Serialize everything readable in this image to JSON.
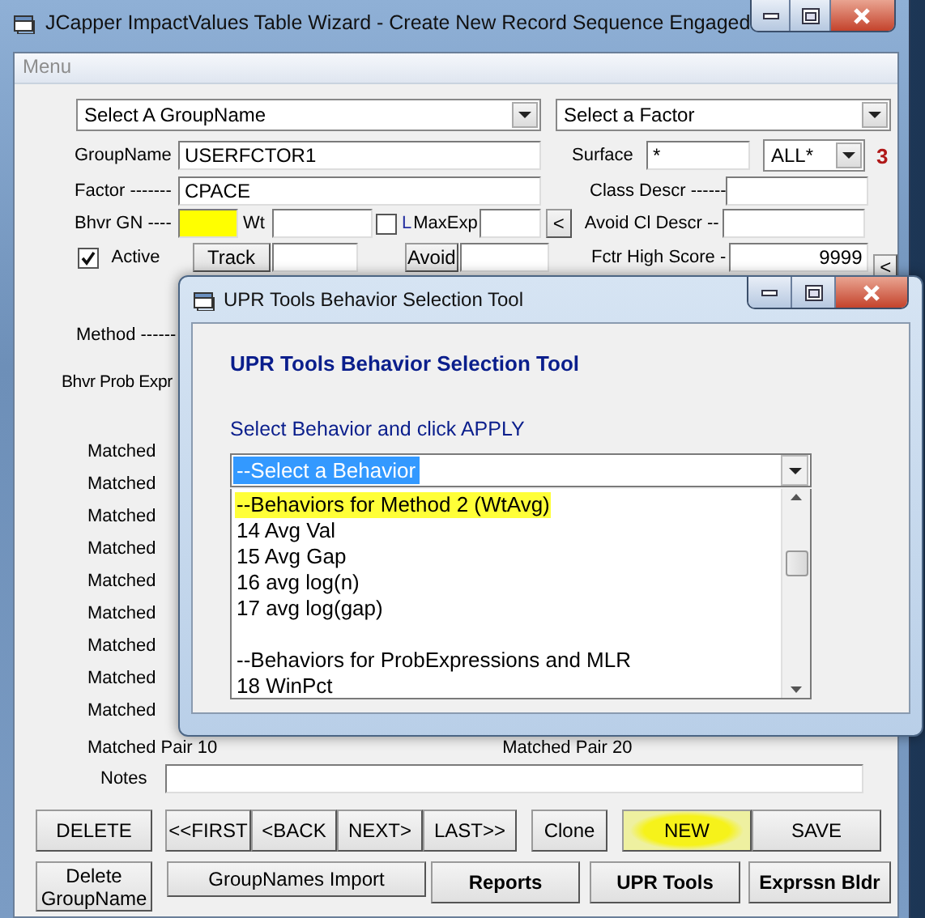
{
  "window": {
    "title": "JCapper ImpactValues Table Wizard -  Create New Record Sequence Engaged"
  },
  "menu": {
    "label": "Menu",
    "disabled": true
  },
  "group_combo": {
    "value": "Select A GroupName"
  },
  "factor_combo": {
    "value": "Select a Factor"
  },
  "group_name": {
    "label": "GroupName",
    "value": "USERFCTOR1"
  },
  "surface": {
    "label": "Surface",
    "value": "*",
    "option": "ALL*",
    "count": "3"
  },
  "factor": {
    "label": "Factor -------",
    "value": "CPACE"
  },
  "class_descr": {
    "label": "Class Descr ------"
  },
  "bhvr_gn": {
    "label": "Bhvr GN ----",
    "highlighted": true
  },
  "wt": {
    "label": "Wt"
  },
  "l_check": {
    "label": "L",
    "checked": false
  },
  "max_exp": {
    "label": "MaxExp",
    "button": "<"
  },
  "avoid_cl_descr": {
    "label": "Avoid Cl Descr --"
  },
  "active": {
    "label": "Active",
    "checked": true
  },
  "track_button": "Track",
  "avoid_button": "Avoid",
  "fctr_high_score": {
    "label": "Fctr High Score -",
    "value": "9999",
    "button": "<"
  },
  "method_label": "Method ------",
  "bhvr_prob_expr_label": "Bhvr Prob Expr",
  "matched_labels": [
    "Matched",
    "Matched",
    "Matched",
    "Matched",
    "Matched",
    "Matched",
    "Matched",
    "Matched",
    "Matched"
  ],
  "matched_pair_labels": [
    "Matched Pair 10",
    "Matched Pair 20"
  ],
  "notes_label": "Notes",
  "buttons_row1": [
    {
      "label": "DELETE",
      "highlighted": false
    },
    {
      "label": "<<FIRST",
      "highlighted": false
    },
    {
      "label": "<BACK",
      "highlighted": false
    },
    {
      "label": "NEXT>",
      "highlighted": false
    },
    {
      "label": "LAST>>",
      "highlighted": false
    },
    {
      "label": "Clone",
      "highlighted": false
    },
    {
      "label": "NEW",
      "highlighted": true
    },
    {
      "label": "SAVE",
      "highlighted": false
    }
  ],
  "buttons_row2": [
    {
      "label": "Delete GroupName",
      "bold": false
    },
    {
      "label": "GroupNames Import",
      "bold": false
    },
    {
      "label": "Reports",
      "bold": true
    },
    {
      "label": "UPR Tools",
      "bold": true
    },
    {
      "label": "Exprssn Bldr",
      "bold": true
    }
  ],
  "dialog": {
    "title": "UPR Tools Behavior Selection Tool",
    "heading": "UPR Tools Behavior Selection Tool",
    "instruction": "Select Behavior and click APPLY",
    "combo": {
      "value": "--Select a Behavior"
    },
    "options": [
      {
        "kind": "header",
        "label": "--Behaviors for Method 2 (WtAvg)",
        "highlighted": true
      },
      {
        "kind": "item",
        "label": "14 Avg Val",
        "highlighted": false
      },
      {
        "kind": "item",
        "label": "15 Avg Gap",
        "highlighted": false
      },
      {
        "kind": "item",
        "label": "16 avg log(n)",
        "highlighted": false
      },
      {
        "kind": "item",
        "label": "17 avg log(gap)",
        "highlighted": false
      },
      {
        "kind": "blank"
      },
      {
        "kind": "header",
        "label": "--Behaviors for ProbExpressions and MLR",
        "highlighted": false
      },
      {
        "kind": "item",
        "label": "18 WinPct",
        "highlighted": false
      }
    ]
  }
}
